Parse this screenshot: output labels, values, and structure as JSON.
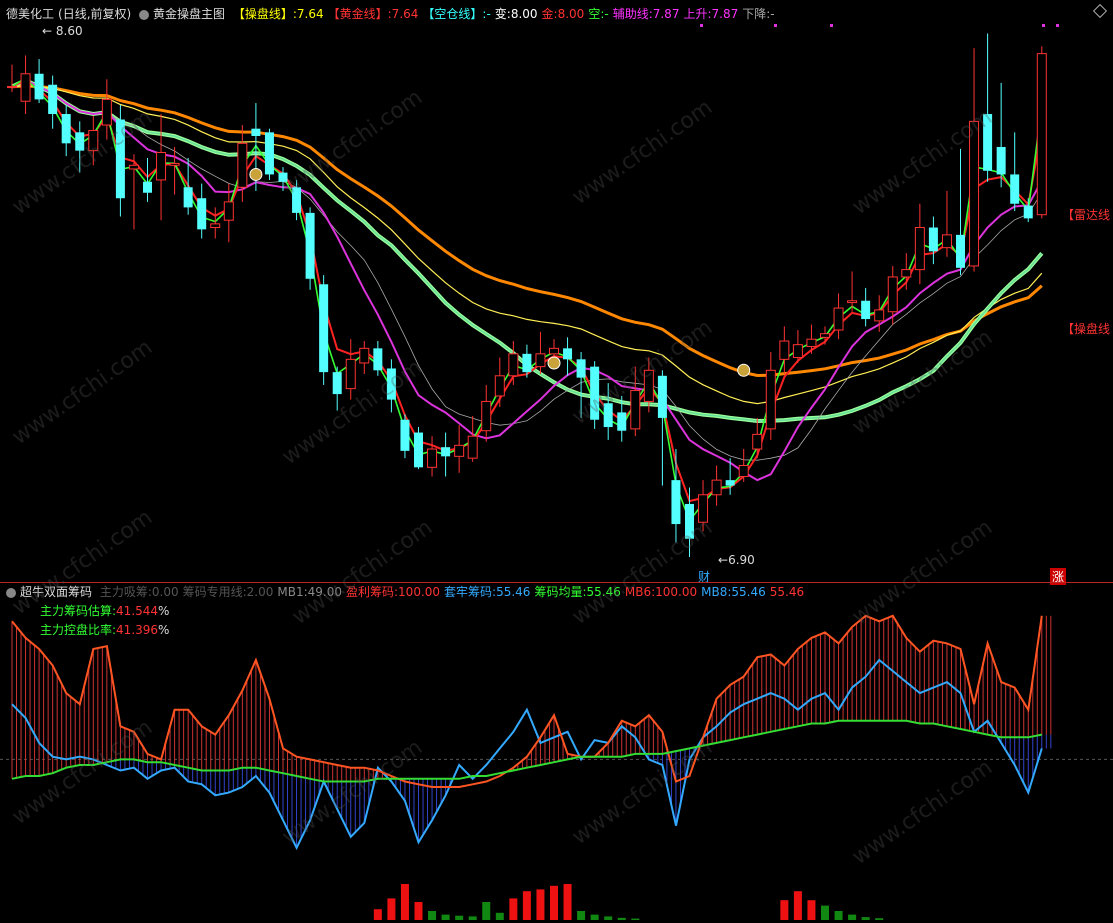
{
  "top_bar": {
    "stock": "德美化工",
    "period": "(日线,前复权)",
    "indicator": "黄金操盘主图",
    "items": [
      {
        "label": "【操盘线】:",
        "value": "7.64",
        "color": "#ffff00"
      },
      {
        "label": "【黄金线】:",
        "value": "7.64",
        "color": "#ff3333"
      },
      {
        "label": "【空仓线】:",
        "value": "-",
        "color": "#33ffff"
      },
      {
        "label": "变:",
        "value": "8.00",
        "color": "#ffffff"
      },
      {
        "label": "金:",
        "value": "8.00",
        "color": "#ff3333"
      },
      {
        "label": "空:",
        "value": "-",
        "color": "#33ff33"
      },
      {
        "label": "辅助线:",
        "value": "7.87",
        "color": "#ff33ff"
      },
      {
        "label": "上升:",
        "value": "7.87",
        "color": "#ff33ff"
      },
      {
        "label": "下降:",
        "value": "-",
        "color": "#aaaaaa"
      }
    ]
  },
  "price_panel": {
    "high_label": "8.60",
    "low_label": "6.90",
    "cai_label": "财",
    "zhang_label": "涨",
    "radar_label": "【雷达线",
    "caopan_label": "【操盘线"
  },
  "ind_bar": {
    "name": "超牛双面筹码",
    "items": [
      {
        "label": "主力吸筹:",
        "value": "0.00",
        "color": "#555555"
      },
      {
        "label": "筹码专用线:",
        "value": "2.00",
        "color": "#555555"
      },
      {
        "label": "MB1:",
        "value": "49.00",
        "color": "#888888"
      },
      {
        "label": "盈利筹码:",
        "value": "100.00",
        "color": "#ff3333"
      },
      {
        "label": "套牢筹码:",
        "value": "55.46",
        "color": "#33aaff"
      },
      {
        "label": "筹码均量:",
        "value": "55.46",
        "color": "#33ff33"
      },
      {
        "label": "MB6:",
        "value": "100.00",
        "color": "#ff3333"
      },
      {
        "label": "MB8:",
        "value": "55.46",
        "color": "#33aaff"
      },
      {
        "label": "",
        "value": "55.46",
        "color": "#ff3333"
      }
    ],
    "estimate_label": "主力筹码估算:",
    "estimate_value": "41.544",
    "control_label": "主力控盘比率:",
    "control_value": "41.396",
    "pct": "%"
  },
  "watermark": "www.cfchi.com",
  "colors": {
    "up": "#ff3333",
    "down": "#54ffff",
    "ma_yellow": "#ffff33",
    "ma_purple": "#dd33dd",
    "ma_orange": "#ff8800",
    "ma_green": "#33ff66",
    "profit": "#ff5522",
    "trapped": "#33aaff"
  },
  "candles": [
    [
      8.43,
      8.43,
      8.55,
      8.4
    ],
    [
      8.35,
      8.5,
      8.6,
      8.28
    ],
    [
      8.5,
      8.36,
      8.58,
      8.34
    ],
    [
      8.44,
      8.28,
      8.49,
      8.2
    ],
    [
      8.28,
      8.12,
      8.33,
      8.05
    ],
    [
      8.18,
      8.08,
      8.24,
      7.96
    ],
    [
      8.08,
      8.19,
      8.27,
      8.0
    ],
    [
      8.22,
      8.36,
      8.47,
      8.14
    ],
    [
      8.25,
      7.82,
      8.33,
      7.72
    ],
    [
      7.98,
      8.0,
      8.06,
      7.65
    ],
    [
      7.91,
      7.85,
      8.04,
      7.8
    ],
    [
      7.92,
      8.07,
      8.28,
      7.7
    ],
    [
      8.0,
      8.01,
      8.1,
      7.84
    ],
    [
      7.88,
      7.77,
      8.04,
      7.73
    ],
    [
      7.82,
      7.65,
      7.9,
      7.6
    ],
    [
      7.66,
      7.68,
      7.77,
      7.6
    ],
    [
      7.7,
      7.8,
      7.9,
      7.58
    ],
    [
      7.88,
      8.12,
      8.22,
      7.8
    ],
    [
      8.2,
      8.16,
      8.34,
      7.86
    ],
    [
      8.18,
      7.95,
      8.2,
      7.92
    ],
    [
      7.96,
      7.91,
      7.99,
      7.86
    ],
    [
      7.88,
      7.74,
      7.92,
      7.7
    ],
    [
      7.74,
      7.38,
      7.77,
      7.32
    ],
    [
      7.35,
      6.87,
      7.4,
      6.8
    ],
    [
      6.87,
      6.75,
      6.9,
      6.66
    ],
    [
      6.78,
      6.94,
      7.05,
      6.72
    ],
    [
      6.92,
      7.0,
      7.04,
      6.86
    ],
    [
      7.0,
      6.88,
      7.04,
      6.85
    ],
    [
      6.89,
      6.72,
      6.94,
      6.65
    ],
    [
      6.61,
      6.44,
      6.64,
      6.4
    ],
    [
      6.54,
      6.35,
      6.57,
      6.34
    ],
    [
      6.35,
      6.45,
      6.52,
      6.3
    ],
    [
      6.46,
      6.41,
      6.54,
      6.3
    ],
    [
      6.41,
      6.47,
      6.58,
      6.32
    ],
    [
      6.4,
      6.52,
      6.63,
      6.38
    ],
    [
      6.55,
      6.71,
      6.8,
      6.49
    ],
    [
      6.74,
      6.85,
      6.95,
      6.68
    ],
    [
      6.85,
      6.97,
      7.04,
      6.8
    ],
    [
      6.97,
      6.87,
      7.02,
      6.84
    ],
    [
      6.9,
      6.97,
      7.09,
      6.86
    ],
    [
      6.97,
      7.0,
      7.05,
      6.9
    ],
    [
      7.0,
      6.94,
      7.06,
      6.85
    ],
    [
      6.94,
      6.84,
      6.98,
      6.62
    ],
    [
      6.9,
      6.61,
      6.93,
      6.56
    ],
    [
      6.7,
      6.57,
      6.81,
      6.5
    ],
    [
      6.65,
      6.55,
      6.74,
      6.49
    ],
    [
      6.56,
      6.77,
      6.9,
      6.52
    ],
    [
      6.71,
      6.88,
      6.95,
      6.65
    ],
    [
      6.85,
      6.62,
      6.88,
      6.25
    ],
    [
      6.28,
      6.04,
      6.45,
      5.94
    ],
    [
      6.15,
      5.96,
      6.24,
      5.86
    ],
    [
      6.05,
      6.2,
      6.28,
      6.0
    ],
    [
      6.2,
      6.28,
      6.36,
      6.14
    ],
    [
      6.28,
      6.25,
      6.4,
      6.2
    ],
    [
      6.3,
      6.36,
      6.45,
      6.27
    ],
    [
      6.45,
      6.53,
      6.62,
      6.4
    ],
    [
      6.56,
      6.88,
      6.98,
      6.5
    ],
    [
      6.94,
      7.04,
      7.12,
      6.86
    ],
    [
      6.95,
      7.02,
      7.1,
      6.92
    ],
    [
      7.01,
      7.05,
      7.13,
      6.97
    ],
    [
      7.06,
      7.08,
      7.12,
      7.02
    ],
    [
      7.1,
      7.22,
      7.3,
      7.05
    ],
    [
      7.25,
      7.26,
      7.42,
      7.2
    ],
    [
      7.26,
      7.16,
      7.33,
      7.12
    ],
    [
      7.15,
      7.21,
      7.29,
      7.09
    ],
    [
      7.2,
      7.39,
      7.45,
      7.13
    ],
    [
      7.39,
      7.43,
      7.52,
      7.32
    ],
    [
      7.43,
      7.66,
      7.79,
      7.35
    ],
    [
      7.66,
      7.53,
      7.72,
      7.46
    ],
    [
      7.55,
      7.62,
      7.86,
      7.5
    ],
    [
      7.62,
      7.44,
      8.09,
      7.4
    ],
    [
      7.45,
      8.24,
      8.64,
      7.42
    ],
    [
      8.28,
      7.97,
      8.72,
      7.91
    ],
    [
      8.1,
      7.95,
      8.45,
      7.88
    ],
    [
      7.95,
      7.79,
      8.18,
      7.75
    ],
    [
      7.78,
      7.71,
      7.82,
      7.69
    ],
    [
      7.73,
      8.61,
      8.65,
      7.71
    ]
  ],
  "ind_profit": [
    98,
    92,
    88,
    82,
    72,
    68,
    88,
    89,
    60,
    58,
    50,
    48,
    66,
    66,
    60,
    57,
    64,
    73,
    84,
    70,
    52,
    49,
    48,
    47,
    46,
    45,
    45,
    44,
    42,
    40,
    39,
    38,
    38,
    38,
    39,
    40,
    42,
    45,
    49,
    56,
    64,
    50,
    49,
    49,
    54,
    62,
    60,
    64,
    58,
    40,
    42,
    56,
    70,
    75,
    78,
    85,
    86,
    82,
    88,
    92,
    94,
    90,
    96,
    100,
    98,
    100,
    92,
    87,
    91,
    90,
    88,
    68,
    90,
    76,
    74,
    66,
    100
  ],
  "ind_trapped": [
    68,
    63,
    54,
    49,
    48,
    49,
    48,
    46,
    44,
    45,
    41,
    44,
    45,
    40,
    39,
    35,
    36,
    38,
    42,
    36,
    26,
    16,
    26,
    40,
    30,
    20,
    25,
    45,
    40,
    33,
    18,
    26,
    35,
    46,
    41,
    46,
    52,
    58,
    66,
    54,
    56,
    58,
    48,
    55,
    54,
    60,
    56,
    48,
    46,
    24,
    48,
    56,
    60,
    65,
    68,
    70,
    72,
    70,
    66,
    70,
    72,
    66,
    74,
    78,
    84,
    80,
    76,
    72,
    74,
    76,
    72,
    58,
    62,
    54,
    46,
    36,
    52
  ],
  "ind_avg": [
    41,
    42,
    42,
    43,
    45,
    46,
    46,
    47,
    48,
    48,
    47,
    47,
    46,
    45,
    44,
    44,
    44,
    45,
    45,
    44,
    43,
    42,
    41,
    40,
    40,
    40,
    40,
    41,
    41,
    41,
    41,
    41,
    41,
    41,
    42,
    42,
    43,
    44,
    45,
    46,
    47,
    48,
    49,
    49,
    49,
    49,
    50,
    50,
    50,
    51,
    52,
    53,
    54,
    55,
    56,
    57,
    58,
    59,
    60,
    61,
    61,
    62,
    62,
    62,
    62,
    62,
    62,
    61,
    61,
    60,
    59,
    58,
    57,
    56,
    56,
    56,
    57
  ],
  "ind_vol": [
    0,
    0,
    0,
    0,
    0,
    0,
    0,
    0,
    0,
    0,
    0,
    0,
    0,
    0,
    0,
    0,
    0,
    0,
    0,
    0,
    0,
    0,
    0,
    0,
    0,
    0,
    0,
    0,
    0,
    0,
    0,
    0,
    0,
    0,
    0,
    0,
    0,
    0,
    0,
    0,
    0,
    0,
    0,
    0,
    0,
    0,
    0,
    0,
    0,
    0,
    0,
    0,
    0,
    0,
    0,
    0,
    0,
    0,
    0,
    0,
    0,
    0,
    0,
    0,
    0,
    0,
    0,
    0,
    0,
    0,
    0,
    0,
    0,
    0,
    0,
    0,
    0
  ],
  "ind_vol_bars": [
    {
      "i": 27,
      "v": 0.3,
      "c": "up"
    },
    {
      "i": 28,
      "v": 0.6,
      "c": "up"
    },
    {
      "i": 29,
      "v": 1.0,
      "c": "up"
    },
    {
      "i": 30,
      "v": 0.5,
      "c": "up"
    },
    {
      "i": 31,
      "v": 0.25,
      "c": "down"
    },
    {
      "i": 32,
      "v": 0.15,
      "c": "down"
    },
    {
      "i": 33,
      "v": 0.12,
      "c": "down"
    },
    {
      "i": 34,
      "v": 0.1,
      "c": "down"
    },
    {
      "i": 35,
      "v": 0.5,
      "c": "down"
    },
    {
      "i": 36,
      "v": 0.2,
      "c": "down"
    },
    {
      "i": 37,
      "v": 0.6,
      "c": "up"
    },
    {
      "i": 38,
      "v": 0.8,
      "c": "up"
    },
    {
      "i": 39,
      "v": 0.85,
      "c": "up"
    },
    {
      "i": 40,
      "v": 0.95,
      "c": "up"
    },
    {
      "i": 41,
      "v": 1.0,
      "c": "up"
    },
    {
      "i": 42,
      "v": 0.25,
      "c": "down"
    },
    {
      "i": 43,
      "v": 0.15,
      "c": "down"
    },
    {
      "i": 44,
      "v": 0.1,
      "c": "down"
    },
    {
      "i": 45,
      "v": 0.06,
      "c": "down"
    },
    {
      "i": 46,
      "v": 0.04,
      "c": "down"
    },
    {
      "i": 57,
      "v": 0.55,
      "c": "up"
    },
    {
      "i": 58,
      "v": 0.8,
      "c": "up"
    },
    {
      "i": 59,
      "v": 0.55,
      "c": "up"
    },
    {
      "i": 60,
      "v": 0.4,
      "c": "down"
    },
    {
      "i": 61,
      "v": 0.25,
      "c": "down"
    },
    {
      "i": 62,
      "v": 0.15,
      "c": "down"
    },
    {
      "i": 63,
      "v": 0.08,
      "c": "down"
    },
    {
      "i": 64,
      "v": 0.05,
      "c": "down"
    }
  ]
}
